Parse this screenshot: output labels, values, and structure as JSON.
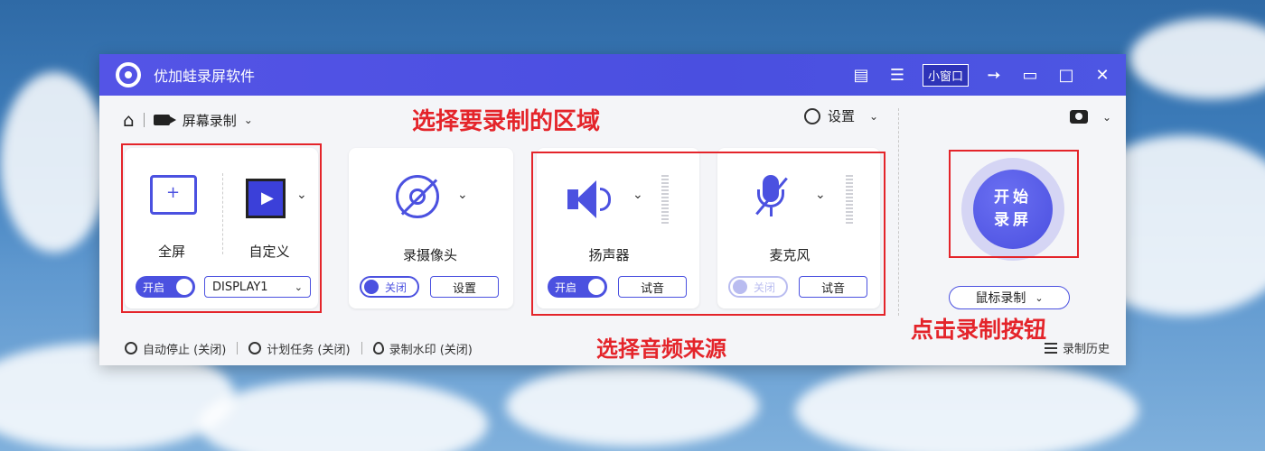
{
  "window": {
    "title": "优加蛙录屏软件",
    "mini_window_label": "小窗口"
  },
  "toolbar": {
    "mode_label": "屏幕录制",
    "settings_label": "设置"
  },
  "annotations": {
    "select_area": "选择要录制的区域",
    "select_audio": "选择音频来源",
    "click_record": "点击录制按钮"
  },
  "screen_card": {
    "fullscreen_label": "全屏",
    "custom_label": "自定义",
    "toggle_label": "开启",
    "display_value": "DISPLAY1"
  },
  "camera_card": {
    "label": "录摄像头",
    "toggle_label": "关闭",
    "settings_button": "设置"
  },
  "speaker_card": {
    "label": "扬声器",
    "toggle_label": "开启",
    "test_button": "试音"
  },
  "mic_card": {
    "label": "麦克风",
    "toggle_label": "关闭",
    "test_button": "试音"
  },
  "record": {
    "start_line1": "开始",
    "start_line2": "录屏",
    "mouse_mode": "鼠标录制"
  },
  "bottom_bar": {
    "auto_stop": "自动停止 (关闭)",
    "schedule": "计划任务 (关闭)",
    "watermark": "录制水印 (关闭)",
    "history": "录制历史"
  },
  "colors": {
    "accent": "#4b51e0",
    "annotation": "#e4242a",
    "titlebar": "#5054e4"
  }
}
